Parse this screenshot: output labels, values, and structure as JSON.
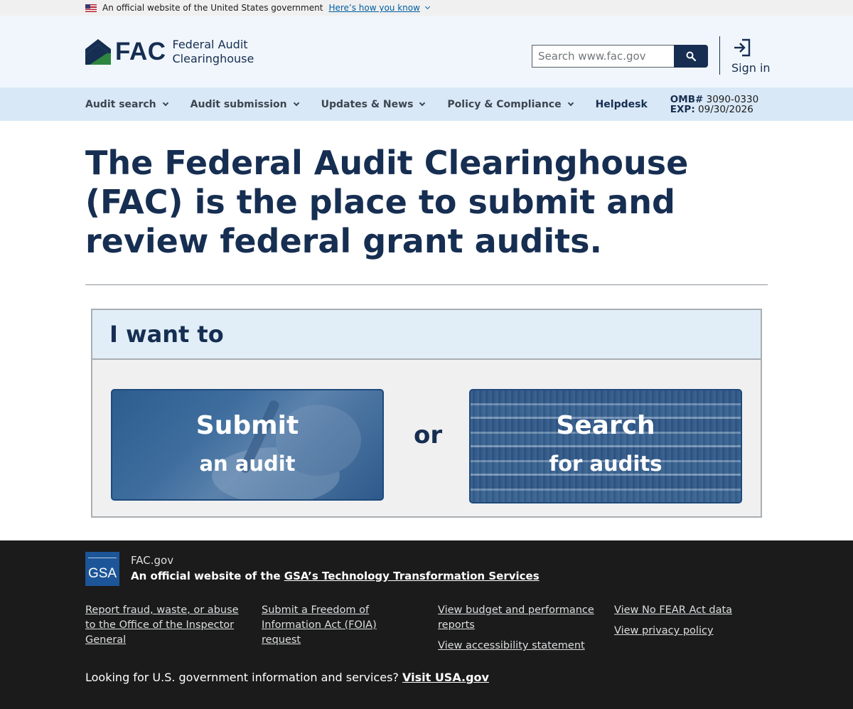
{
  "gov_banner": {
    "text": "An official website of the United States government",
    "link": "Here’s how you know"
  },
  "header": {
    "logo_text": "FAC",
    "logo_sub_line1": "Federal Audit",
    "logo_sub_line2": "Clearinghouse",
    "search_placeholder": "Search www.fac.gov",
    "sign_in": "Sign in"
  },
  "nav": {
    "items": [
      {
        "label": "Audit search"
      },
      {
        "label": "Audit submission"
      },
      {
        "label": "Updates & News"
      },
      {
        "label": "Policy & Compliance"
      }
    ],
    "helpdesk": "Helpdesk",
    "omb_label": "OMB#",
    "omb_value": "3090-0330",
    "exp_label": "EXP:",
    "exp_value": "09/30/2026"
  },
  "hero": {
    "title": "The Federal Audit Clearinghouse (FAC) is the place to submit and review federal grant audits."
  },
  "panel": {
    "heading": "I want to",
    "submit_big": "Submit",
    "submit_small": "an audit",
    "or": "or",
    "search_big": "Search",
    "search_small": "for audits"
  },
  "footer": {
    "logo_text": "GSA",
    "site": "FAC.gov",
    "official_prefix": "An official website of the",
    "official_link": "GSA’s Technology Transformation Services",
    "col1": [
      "Report fraud, waste, or abuse to the Office of the Inspector General"
    ],
    "col2": [
      "Submit a Freedom of Information Act (FOIA) request"
    ],
    "col3": [
      "View budget and performance reports",
      "View accessibility statement"
    ],
    "col4": [
      "View No FEAR Act data",
      "View privacy policy"
    ],
    "bottom_text": "Looking for U.S. government information and services?",
    "bottom_link": "Visit USA.gov"
  },
  "colors": {
    "primary_dark": "#162e51",
    "header_bg": "#f0f6fb",
    "nav_bg": "#d9e8f6",
    "footer_bg": "#1b1b1b",
    "link_blue": "#005ea2"
  }
}
